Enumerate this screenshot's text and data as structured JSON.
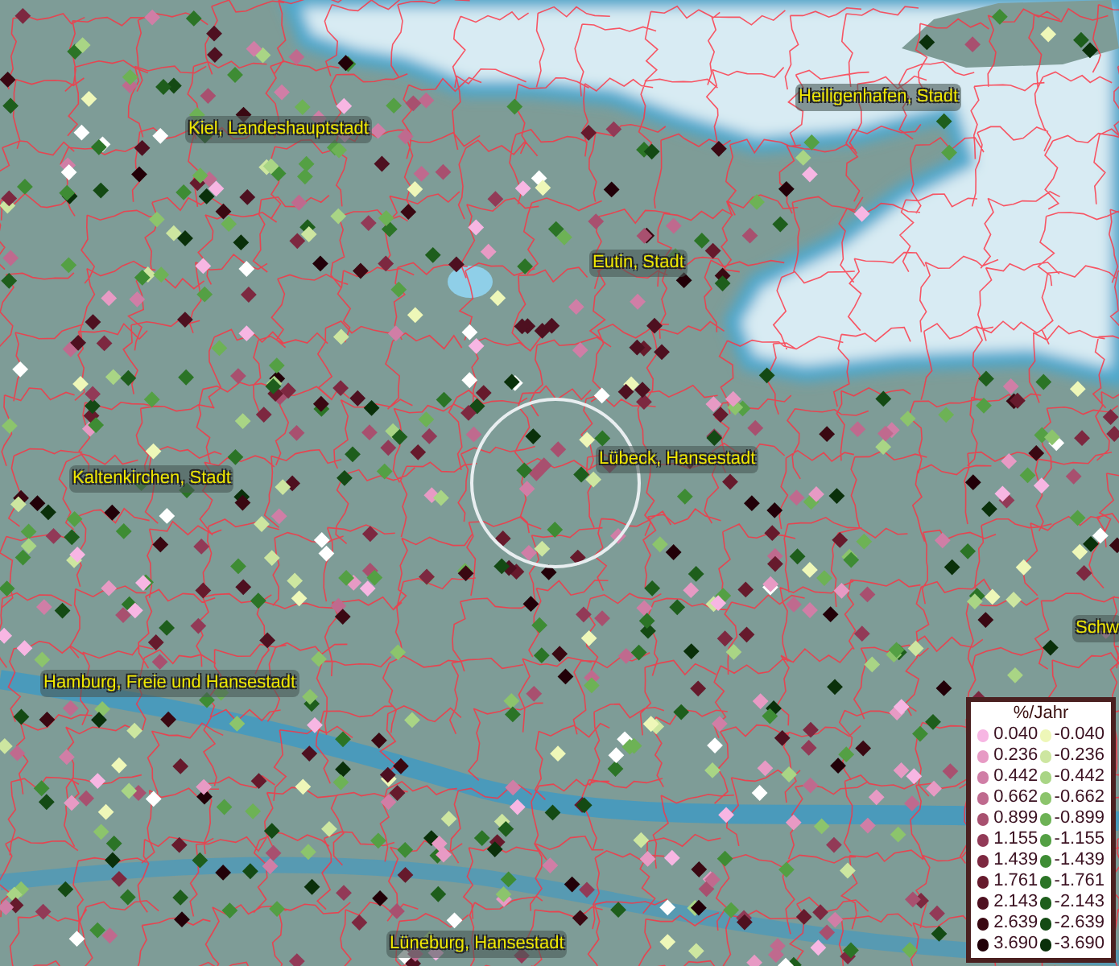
{
  "map": {
    "places": [
      {
        "name": "Kiel, Landeshauptstadt"
      },
      {
        "name": "Heiligenhafen, Stadt"
      },
      {
        "name": "Eutin, Stadt"
      },
      {
        "name": "Lübeck, Hansestadt"
      },
      {
        "name": "Kaltenkirchen, Stadt"
      },
      {
        "name": "Schw"
      },
      {
        "name": "Hamburg, Freie und Hansestadt"
      },
      {
        "name": "Lüneburg, Hansestadt"
      }
    ]
  },
  "legend": {
    "title": "%/Jahr",
    "rows": [
      {
        "positive": {
          "value": "0.040",
          "color": "#f7b6e3"
        },
        "negative": {
          "value": "-0.040",
          "color": "#eef7b8"
        }
      },
      {
        "positive": {
          "value": "0.236",
          "color": "#e79ac4"
        },
        "negative": {
          "value": "-0.236",
          "color": "#cde6a0"
        }
      },
      {
        "positive": {
          "value": "0.442",
          "color": "#d07ea6"
        },
        "negative": {
          "value": "-0.442",
          "color": "#a9d585"
        }
      },
      {
        "positive": {
          "value": "0.662",
          "color": "#bf6a8e"
        },
        "negative": {
          "value": "-0.662",
          "color": "#8cc46c"
        }
      },
      {
        "positive": {
          "value": "0.899",
          "color": "#a8506f"
        },
        "negative": {
          "value": "-0.899",
          "color": "#6db255"
        }
      },
      {
        "positive": {
          "value": "1.155",
          "color": "#923a57"
        },
        "negative": {
          "value": "-1.155",
          "color": "#54a044"
        }
      },
      {
        "positive": {
          "value": "1.439",
          "color": "#7d2840"
        },
        "negative": {
          "value": "-1.439",
          "color": "#3e8c34"
        }
      },
      {
        "positive": {
          "value": "1.761",
          "color": "#661a2c"
        },
        "negative": {
          "value": "-1.761",
          "color": "#2b7426"
        }
      },
      {
        "positive": {
          "value": "2.143",
          "color": "#4e1020"
        },
        "negative": {
          "value": "-2.143",
          "color": "#1e5e1c"
        }
      },
      {
        "positive": {
          "value": "2.639",
          "color": "#3a0812"
        },
        "negative": {
          "value": "-2.639",
          "color": "#144a14"
        }
      },
      {
        "positive": {
          "value": "3.690",
          "color": "#220008"
        },
        "negative": {
          "value": "-3.690",
          "color": "#0a300a"
        }
      }
    ]
  }
}
